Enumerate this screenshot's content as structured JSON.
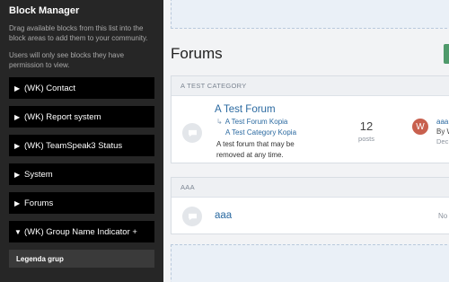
{
  "sidebar": {
    "title": "Block Manager",
    "desc1": "Drag available blocks from this list into the block areas to add them to your community.",
    "desc2": "Users will only see blocks they have permission to view.",
    "blocks": [
      {
        "label": "(WK) Contact",
        "caret": "▶"
      },
      {
        "label": "(WK) Report system",
        "caret": "▶"
      },
      {
        "label": "(WK) TeamSpeak3 Status",
        "caret": "▶"
      },
      {
        "label": "System",
        "caret": "▶"
      },
      {
        "label": "Forums",
        "caret": "▶"
      },
      {
        "label": "(WK) Group Name Indicator +",
        "caret": "▼"
      }
    ],
    "child": "Legenda grup"
  },
  "main": {
    "title": "Forums",
    "categories": [
      {
        "header": "A TEST CATEGORY",
        "forum": {
          "title": "A Test Forum",
          "subforums": [
            "A Test Forum Kopia",
            "A Test Category Kopia"
          ],
          "sub_arrow": "↳",
          "desc": "A test forum that may be removed at any time.",
          "posts_value": "12",
          "posts_label": "posts",
          "avatar_letter": "W",
          "last_title": "aaa",
          "last_by": "By W",
          "last_date": "Dec"
        }
      },
      {
        "header": "AAA",
        "forum": {
          "title": "aaa",
          "no_posts": "No"
        }
      }
    ]
  },
  "colors": {
    "sidebar_bg": "#262626",
    "block_bg": "#000000",
    "link": "#2b6aa1",
    "avatar": "#c8604e",
    "button": "#4f9a6b"
  }
}
